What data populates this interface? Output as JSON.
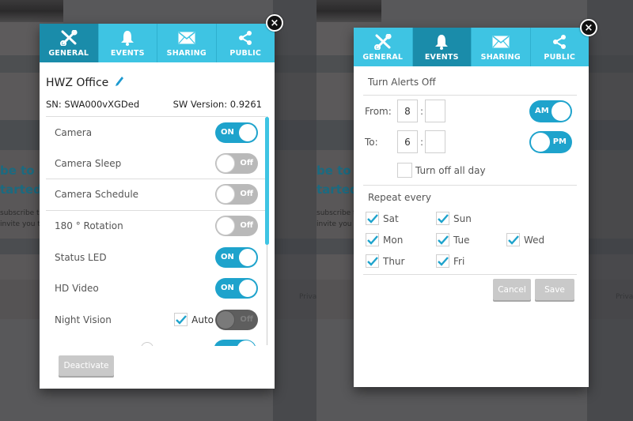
{
  "background": {
    "headline_lines": [
      "be to a",
      "tarted."
    ],
    "sub_lines": [
      "subscribe t",
      "invite you t"
    ],
    "footer_link": "Priva"
  },
  "tabs": [
    {
      "label": "GENERAL",
      "icon": "tools-icon"
    },
    {
      "label": "EVENTS",
      "icon": "bell-icon"
    },
    {
      "label": "SHARING",
      "icon": "envelope-icon"
    },
    {
      "label": "PUBLIC",
      "icon": "share-icon"
    }
  ],
  "general_panel": {
    "active_tab": "GENERAL",
    "close_label": "×",
    "camera_name": "HWZ Office",
    "serial": "SN: SWA000vXGDed",
    "sw_version": "SW Version: 0.9261",
    "settings": [
      {
        "label": "Camera",
        "state": "on",
        "state_label": "ON"
      },
      {
        "label": "Camera Sleep",
        "state": "off",
        "state_label": "Off"
      },
      {
        "label": "Camera Schedule",
        "state": "off",
        "state_label": "Off"
      },
      {
        "label": "180 ° Rotation",
        "state": "off",
        "state_label": "Off"
      },
      {
        "label": "Status LED",
        "state": "on",
        "state_label": "ON"
      },
      {
        "label": "HD Video",
        "state": "on",
        "state_label": "ON"
      },
      {
        "label": "Night Vision",
        "state": "disabled-off",
        "state_label": "Off",
        "auto_label": "Auto",
        "auto_checked": true
      }
    ],
    "scroll_position": 0.0,
    "deactivate_label": "Deactivate"
  },
  "events_panel": {
    "active_tab": "EVENTS",
    "close_label": "×",
    "section_title": "Turn Alerts Off",
    "from_label": "From:",
    "from_hour": "8",
    "from_minute": "",
    "from_ampm": "AM",
    "to_label": "To:",
    "to_hour": "6",
    "to_minute": "",
    "to_ampm": "PM",
    "time_separator": ":",
    "all_day_label": "Turn off all day",
    "all_day_checked": false,
    "repeat_title": "Repeat every",
    "days": [
      {
        "label": "Sat",
        "checked": true
      },
      {
        "label": "Sun",
        "checked": true
      },
      {
        "label": "Mon",
        "checked": true
      },
      {
        "label": "Tue",
        "checked": true
      },
      {
        "label": "Wed",
        "checked": true
      },
      {
        "label": "Thur",
        "checked": true
      },
      {
        "label": "Fri",
        "checked": true
      }
    ],
    "cancel_label": "Cancel",
    "save_label": "Save"
  },
  "colors": {
    "tab_bar": "#3ec4e3",
    "tab_active": "#1a8caa",
    "toggle_on": "#1ea3cc",
    "toggle_off": "#b9b9b9",
    "check": "#1ea3cc"
  }
}
